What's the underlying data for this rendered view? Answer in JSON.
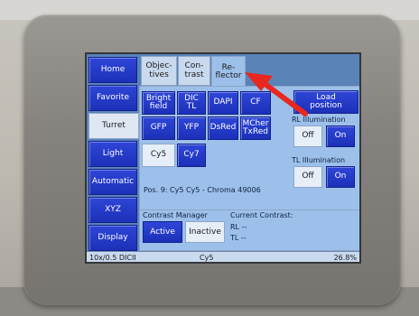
{
  "sidebar": {
    "items": [
      {
        "label": "Home",
        "active": false
      },
      {
        "label": "Favorite",
        "active": false
      },
      {
        "label": "Turret",
        "active": true
      },
      {
        "label": "Light",
        "active": false
      },
      {
        "label": "Automatic",
        "active": false
      },
      {
        "label": "XYZ",
        "active": false
      },
      {
        "label": "Display",
        "active": false
      }
    ]
  },
  "tabs": {
    "objectives": {
      "line1": "Objec-",
      "line2": "tives"
    },
    "contrast": {
      "line1": "Con-",
      "line2": "trast"
    },
    "reflector": {
      "line1": "Re-",
      "line2": "flector"
    },
    "active": "reflector"
  },
  "filters": {
    "row1": [
      {
        "line1": "Bright",
        "line2": "field"
      },
      {
        "line1": "DIC",
        "line2": "TL"
      },
      {
        "line1": "DAPI",
        "line2": ""
      },
      {
        "line1": "CF",
        "line2": ""
      }
    ],
    "row2": [
      {
        "line1": "GFP",
        "line2": ""
      },
      {
        "line1": "YFP",
        "line2": ""
      },
      {
        "line1": "DsRed",
        "line2": ""
      },
      {
        "line1": "MCher",
        "line2": "TxRed"
      }
    ],
    "row3": [
      {
        "line1": "Cy5",
        "line2": "",
        "selected": true
      },
      {
        "line1": "Cy7",
        "line2": "",
        "selected": false
      }
    ]
  },
  "load_position": {
    "line1": "Load",
    "line2": "position"
  },
  "rl_illumination": {
    "label": "RL Illumination",
    "off": "Off",
    "on": "On",
    "state": "On"
  },
  "tl_illumination": {
    "label": "TL Illumination",
    "off": "Off",
    "on": "On",
    "state": "On"
  },
  "position_text": "Pos. 9: Cy5 Cy5 - Chroma 49006",
  "contrast_manager": {
    "label": "Contrast Manager",
    "active": "Active",
    "inactive": "Inactive",
    "state": "Active"
  },
  "current_contrast": {
    "label": "Current Contrast:",
    "rl_label": "RL",
    "rl_value": "--",
    "tl_label": "TL",
    "tl_value": "--"
  },
  "status_bar": {
    "objective": "10x/0.5 DICII",
    "filter": "Cy5",
    "value": "26.8%"
  },
  "colors": {
    "accent_blue": "#1c30b8",
    "panel_blue": "#9cc0ea",
    "arrow_red": "#e8271f"
  }
}
